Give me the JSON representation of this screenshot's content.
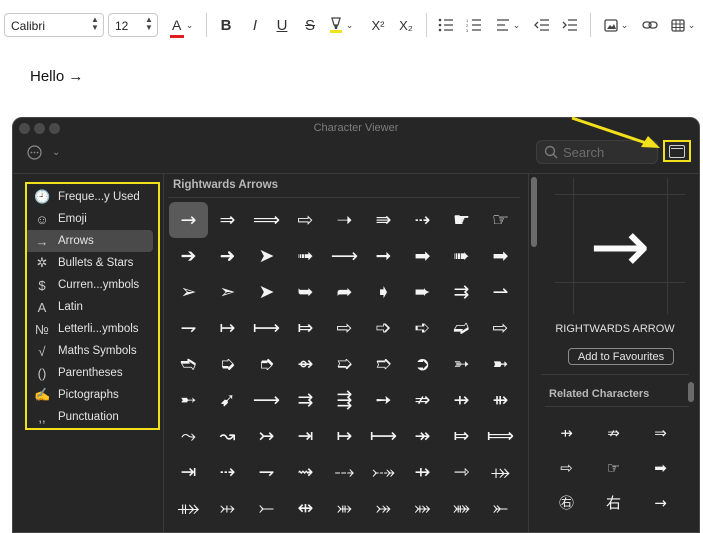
{
  "toolbar": {
    "font_family": "Calibri",
    "font_size": "12",
    "text_color_glyph": "A",
    "bold": "B",
    "italic": "I",
    "underline": "U",
    "strike": "S",
    "superscript": "X²",
    "subscript": "X₂",
    "text_color_swatch": "#e02020",
    "highlight_color": "#f2e11a"
  },
  "document": {
    "text": "Hello →"
  },
  "character_viewer": {
    "title": "Character Viewer",
    "search_placeholder": "Search",
    "sidebar": [
      {
        "label": "Freque...y Used",
        "icon": "clock-icon",
        "glyph": "🕘"
      },
      {
        "label": "Emoji",
        "icon": "smiley-icon",
        "glyph": "☺"
      },
      {
        "label": "Arrows",
        "icon": "arrow-icon",
        "glyph": "→",
        "selected": true
      },
      {
        "label": "Bullets & Stars",
        "icon": "asterisk-icon",
        "glyph": "✲"
      },
      {
        "label": "Curren...ymbols",
        "icon": "dollar-icon",
        "glyph": "$"
      },
      {
        "label": "Latin",
        "icon": "latin-a-icon",
        "glyph": "A"
      },
      {
        "label": "Letterli...ymbols",
        "icon": "numero-icon",
        "glyph": "№"
      },
      {
        "label": "Maths Symbols",
        "icon": "square-root-icon",
        "glyph": "√"
      },
      {
        "label": "Parentheses",
        "icon": "parentheses-icon",
        "glyph": "()"
      },
      {
        "label": "Pictographs",
        "icon": "pictograph-icon",
        "glyph": "✍"
      },
      {
        "label": "Punctuation",
        "icon": "punctuation-icon",
        "glyph": ",,"
      }
    ],
    "section_title": "Rightwards Arrows",
    "characters": [
      "→",
      "⇒",
      "⟹",
      "⇨",
      "➝",
      "⇛",
      "⇢",
      "☛",
      "☞",
      "➔",
      "➜",
      "➤",
      "➟",
      "⟶",
      "➞",
      "➡",
      "➠",
      "➡",
      "➢",
      "➣",
      "➤",
      "➥",
      "➦",
      "➧",
      "➨",
      "⇉",
      "⇀",
      "⇁",
      "↦",
      "⟼",
      "⤇",
      "⇨",
      "➩",
      "➪",
      "➫",
      "⇨",
      "➬",
      "➭",
      "➮",
      "⇴",
      "➯",
      "➱",
      "➲",
      "➳",
      "➼",
      "➸",
      "➹",
      "⟶",
      "⇉",
      "⇶",
      "➙",
      "⇏",
      "⇸",
      "⇻",
      "⤳",
      "↝",
      "↣",
      "⇥",
      "↦",
      "⟼",
      "↠",
      "⤇",
      "⟾",
      "⇥",
      "⇢",
      "⇁",
      "⇝",
      "⤏",
      "⤐",
      "⇸",
      "⇾",
      "⤀",
      "⤁",
      "⤔",
      "⤚",
      "⇹",
      "⤕",
      "⤖",
      "⤗",
      "⤘",
      "⤜"
    ],
    "selected_index": 0,
    "detail": {
      "glyph": "→",
      "name": "RIGHTWARDS ARROW",
      "favourites_button": "Add to Favourites",
      "related_title": "Related Characters",
      "related": [
        "⇸",
        "⇏",
        "⇒",
        "⇨",
        "☞",
        "➡",
        "㊨",
        "右",
        "→"
      ]
    }
  }
}
